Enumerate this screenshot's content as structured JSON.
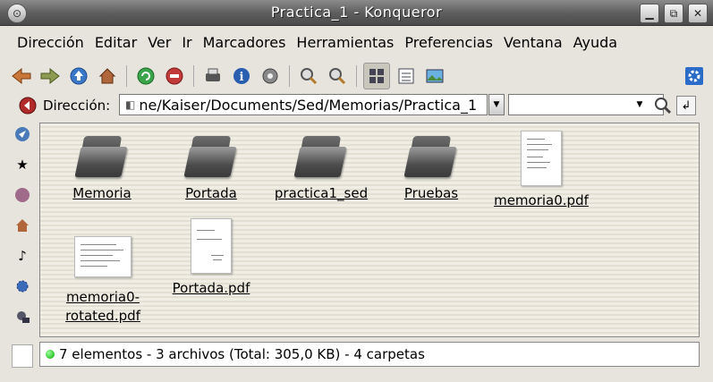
{
  "window": {
    "title": "Practica_1 - Konqueror"
  },
  "menu": [
    {
      "label": "Dirección"
    },
    {
      "label": "Editar"
    },
    {
      "label": "Ver"
    },
    {
      "label": "Ir"
    },
    {
      "label": "Marcadores"
    },
    {
      "label": "Herramientas"
    },
    {
      "label": "Preferencias"
    },
    {
      "label": "Ventana"
    },
    {
      "label": "Ayuda"
    }
  ],
  "toolbar": {
    "icons": [
      "back-arrow-icon",
      "forward-arrow-icon",
      "up-arrow-icon",
      "home-icon",
      "reload-icon",
      "stop-icon",
      "print-icon",
      "info-icon",
      "security-icon",
      "zoom-in-icon",
      "zoom-out-icon",
      "icon-view-icon",
      "tree-view-icon",
      "image-view-icon",
      "konqueror-gear-icon"
    ]
  },
  "location": {
    "label": "Dirección:",
    "value": "ne/Kaiser/Documents/Sed/Memorias/Practica_1",
    "search_value": ""
  },
  "files": [
    {
      "name": "Memoria",
      "type": "folder"
    },
    {
      "name": "Portada",
      "type": "folder"
    },
    {
      "name": "practica1_sed",
      "type": "folder"
    },
    {
      "name": "Pruebas",
      "type": "folder"
    },
    {
      "name": "memoria0.pdf",
      "type": "pdf"
    },
    {
      "name": "memoria0-",
      "name2": "rotated.pdf",
      "type": "pdf-wide"
    },
    {
      "name": "Portada.pdf",
      "type": "pdf"
    }
  ],
  "status": {
    "text": "7 elementos - 3 archivos (Total: 305,0 KB) - 4 carpetas"
  },
  "colors": {
    "titlebar": "#5f5f5f",
    "background": "#e6e4dc",
    "status_led": "#00aa00"
  }
}
